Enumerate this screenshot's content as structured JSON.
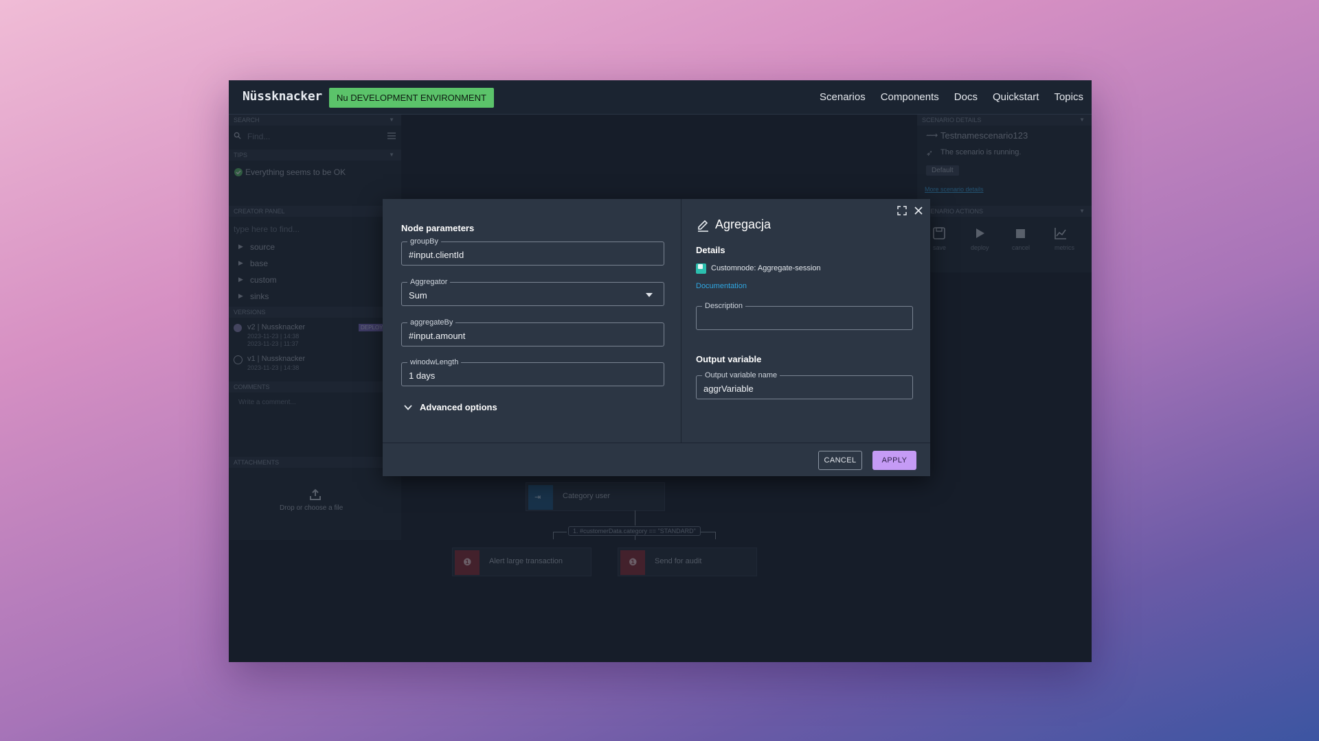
{
  "app": {
    "logo": "Nüssknacker",
    "env_badge": "Nu DEVELOPMENT ENVIRONMENT",
    "nav": [
      "Scenarios",
      "Components",
      "Docs",
      "Quickstart",
      "Topics"
    ]
  },
  "left_panel": {
    "search": {
      "header": "SEARCH",
      "placeholder": "Find..."
    },
    "tips": {
      "header": "TIPS",
      "message": "Everything seems to be OK"
    },
    "creator": {
      "header": "CREATOR PANEL",
      "placeholder": "type here to find...",
      "groups": [
        "source",
        "base",
        "custom",
        "sinks"
      ]
    },
    "versions": {
      "header": "VERSIONS",
      "items": [
        {
          "title": "v2 | Nussknacker",
          "created": "2023-11-23 | 14:38",
          "modified": "2023-11-23 | 11:37",
          "badge": "DEPLOYED"
        },
        {
          "title": "v1 | Nussknacker",
          "created": "2023-11-23 | 14:38"
        }
      ]
    },
    "comments": {
      "header": "COMMENTS",
      "placeholder": "Write a comment..."
    },
    "attachments": {
      "header": "ATTACHMENTS",
      "drop_text": "Drop or choose a file"
    }
  },
  "right_panel": {
    "details": {
      "header": "SCENARIO DETAILS",
      "name": "Testnamescenario123",
      "status": "The scenario is running.",
      "category": "Default",
      "more_link": "More scenario details"
    },
    "actions": {
      "header": "SCENARIO ACTIONS",
      "items": [
        "save",
        "deploy",
        "cancel",
        "metrics"
      ]
    }
  },
  "canvas": {
    "nodes": [
      "Category user",
      "Alert large transaction",
      "Send for audit"
    ],
    "edge_label": "1. #customerData.category == \"STANDARD\""
  },
  "modal": {
    "left": {
      "title": "Node parameters",
      "fields": [
        {
          "label": "groupBy",
          "value": "#input.clientId"
        },
        {
          "label": "Aggregator",
          "value": "Sum"
        },
        {
          "label": "aggregateBy",
          "value": "#input.amount"
        },
        {
          "label": "winodwLength",
          "value": "1 days"
        }
      ],
      "advanced": "Advanced options"
    },
    "right": {
      "title": "Agregacja",
      "details_title": "Details",
      "component": "Customnode: Aggregate-session",
      "doc_link": "Documentation",
      "description_label": "Description",
      "description_value": "",
      "output_title": "Output variable",
      "output_label": "Output variable name",
      "output_value": "aggrVariable"
    },
    "buttons": {
      "cancel": "CANCEL",
      "apply": "APPLY"
    }
  },
  "colors": {
    "env_badge": "#5bc36a",
    "apply_button": "#c59bf5",
    "link": "#2fa7e2",
    "component_icon": "#2bbfae",
    "sink_icon": "#8e2832",
    "filter_icon": "#1d5680"
  }
}
